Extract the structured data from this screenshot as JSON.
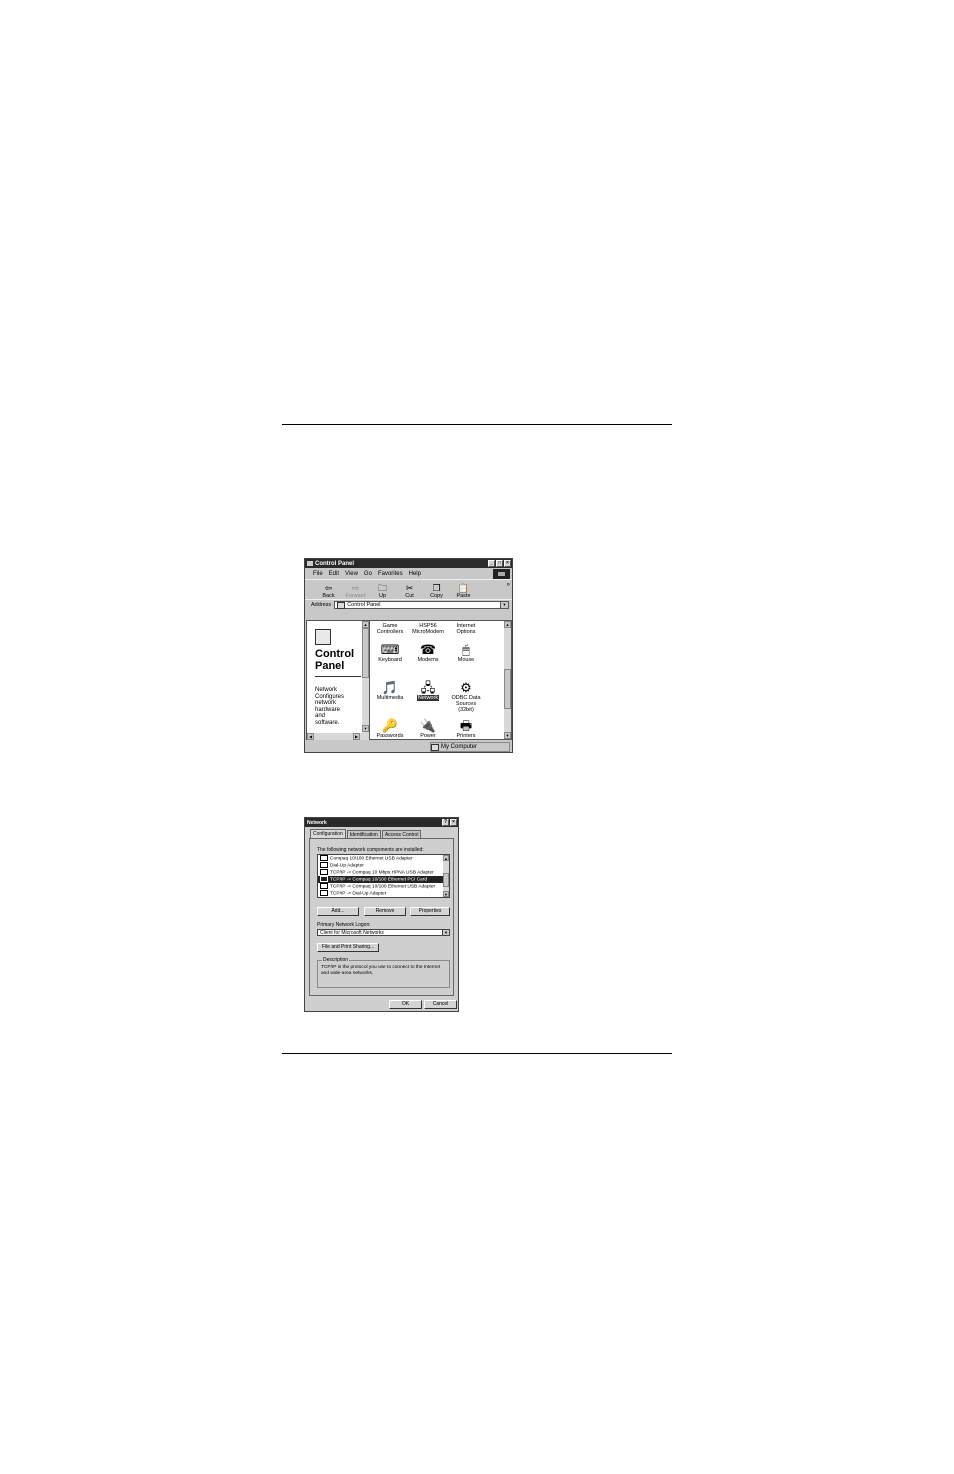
{
  "control_panel": {
    "title": "Control Panel",
    "menu": [
      "File",
      "Edit",
      "View",
      "Go",
      "Favorites",
      "Help"
    ],
    "toolbar": [
      {
        "label": "Back",
        "icon": "back-arrow-icon",
        "glyph": "⇦",
        "disabled": false
      },
      {
        "label": "Forward",
        "icon": "forward-arrow-icon",
        "glyph": "⇨",
        "disabled": true
      },
      {
        "label": "Up",
        "icon": "up-folder-icon",
        "glyph": "🗀",
        "disabled": false
      },
      {
        "label": "Cut",
        "icon": "scissors-icon",
        "glyph": "✂",
        "disabled": false
      },
      {
        "label": "Copy",
        "icon": "copy-icon",
        "glyph": "❐",
        "disabled": false
      },
      {
        "label": "Paste",
        "icon": "paste-icon",
        "glyph": "📋",
        "disabled": false
      }
    ],
    "toolbar_more": "»",
    "address_label": "Address",
    "address_value": "Control Panel",
    "left_panel": {
      "title_line1": "Control",
      "title_line2": "Panel",
      "desc_heading": "Network",
      "desc_lines": [
        "Configures",
        "network",
        "hardware",
        "and",
        "software."
      ]
    },
    "icons": [
      {
        "label": "Game\nControllers",
        "icon": "game-controllers-icon",
        "glyph": "",
        "selected": false
      },
      {
        "label": "HSP56\nMicroModem",
        "icon": "modem-icon",
        "glyph": "",
        "selected": false
      },
      {
        "label": "Internet\nOptions",
        "icon": "internet-options-icon",
        "glyph": "",
        "selected": false
      },
      {
        "label": "Keyboard",
        "icon": "keyboard-icon",
        "glyph": "⌨",
        "selected": false
      },
      {
        "label": "Modems",
        "icon": "modems-icon",
        "glyph": "☎",
        "selected": false
      },
      {
        "label": "Mouse",
        "icon": "mouse-icon",
        "glyph": "🖱",
        "selected": false
      },
      {
        "label": "Multimedia",
        "icon": "multimedia-icon",
        "glyph": "🎵",
        "selected": false
      },
      {
        "label": "Network",
        "icon": "network-icon",
        "glyph": "🖧",
        "selected": true
      },
      {
        "label": "ODBC Data\nSources (32bit)",
        "icon": "odbc-icon",
        "glyph": "⚙",
        "selected": false
      },
      {
        "label": "Passwords",
        "icon": "passwords-icon",
        "glyph": "🔑",
        "selected": false
      },
      {
        "label": "Power",
        "icon": "power-icon",
        "glyph": "🔌",
        "selected": false
      },
      {
        "label": "Printers",
        "icon": "printers-icon",
        "glyph": "🖶",
        "selected": false
      }
    ],
    "status": "My Computer"
  },
  "network": {
    "title": "Network",
    "tabs": [
      "Configuration",
      "Identification",
      "Access Control"
    ],
    "components_label": "The following network components are installed:",
    "components": [
      {
        "text": "Compaq 10/100 Ethernet USB Adapter",
        "selected": false
      },
      {
        "text": "Dial-Up Adapter",
        "selected": false
      },
      {
        "text": "TCP/IP -> Compaq 10 Mbps HPNA USB Adapter",
        "selected": false
      },
      {
        "text": "TCP/IP -> Compaq 10/100 Ethernet PCI Card",
        "selected": true
      },
      {
        "text": "TCP/IP -> Compaq 10/100 Ethernet USB Adapter",
        "selected": false
      },
      {
        "text": "TCP/IP -> Dial-Up Adapter",
        "selected": false
      }
    ],
    "buttons": {
      "add": "Add...",
      "remove": "Remove",
      "properties": "Properties"
    },
    "logon_label": "Primary Network Logon:",
    "logon_value": "Client for Microsoft Networks",
    "sharing_button": "File and Print Sharing...",
    "description_legend": "Description",
    "description_text": "TCP/IP is the protocol you use to connect to the Internet and wide-area networks.",
    "ok": "OK",
    "cancel": "Cancel"
  }
}
